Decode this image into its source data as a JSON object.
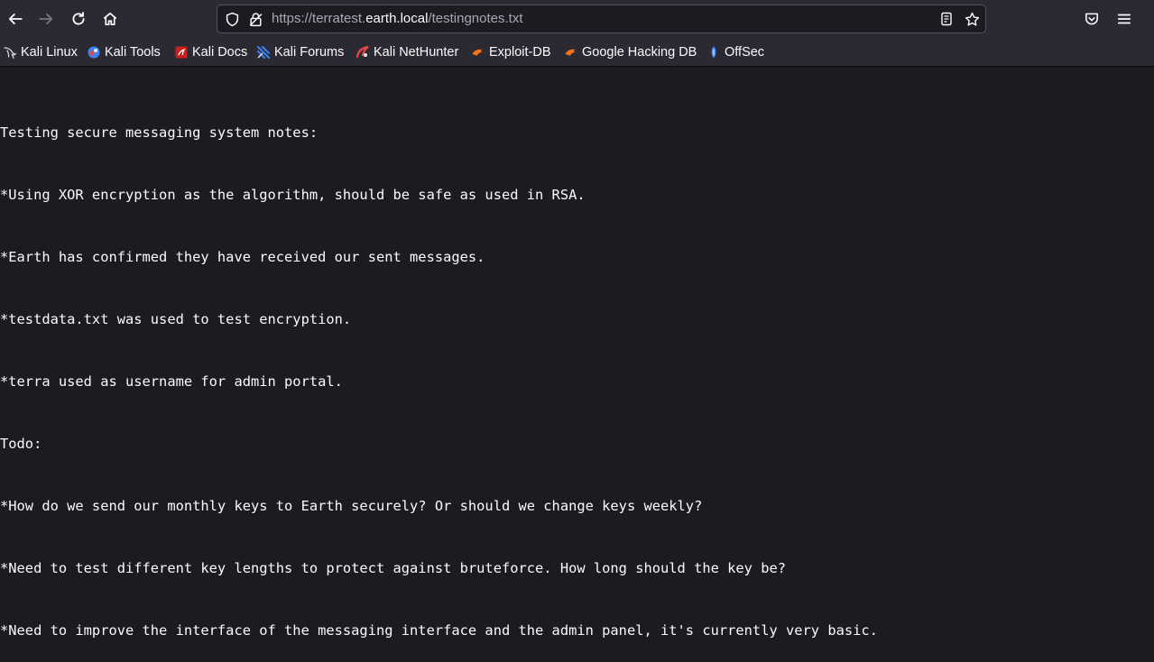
{
  "browser": {
    "url": {
      "scheme": "https://",
      "subdomain": "terratest.",
      "host": "earth.local",
      "path": "/testingnotes.txt"
    }
  },
  "bookmarks": [
    {
      "label": "Kali Linux",
      "icon": "kali-dragon-icon"
    },
    {
      "label": "Kali Tools",
      "icon": "kali-tools-icon"
    },
    {
      "label": "Kali Docs",
      "icon": "kali-docs-icon"
    },
    {
      "label": "Kali Forums",
      "icon": "kali-forums-icon"
    },
    {
      "label": "Kali NetHunter",
      "icon": "nethunter-icon"
    },
    {
      "label": "Exploit-DB",
      "icon": "exploit-db-icon"
    },
    {
      "label": "Google Hacking DB",
      "icon": "ghdb-icon"
    },
    {
      "label": "OffSec",
      "icon": "offsec-icon"
    }
  ],
  "document": {
    "lines": [
      "Testing secure messaging system notes:",
      "*Using XOR encryption as the algorithm, should be safe as used in RSA.",
      "*Earth has confirmed they have received our sent messages.",
      "*testdata.txt was used to test encryption.",
      "*terra used as username for admin portal.",
      "Todo:",
      "*How do we send our monthly keys to Earth securely? Or should we change keys weekly?",
      "*Need to test different key lengths to protect against bruteforce. How long should the key be?",
      "*Need to improve the interface of the messaging interface and the admin panel, it's currently very basic."
    ]
  }
}
